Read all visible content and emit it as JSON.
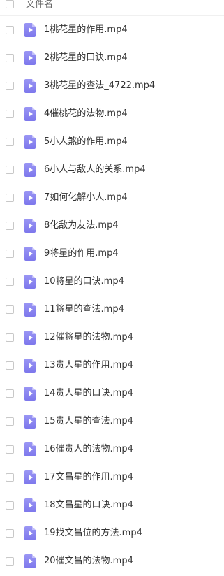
{
  "header": {
    "column_label": "文件名"
  },
  "files": [
    {
      "name": "1桃花星的作用.mp4",
      "icon": "video-file-icon"
    },
    {
      "name": "2桃花星的口诀.mp4",
      "icon": "video-file-icon"
    },
    {
      "name": "3桃花星的查法_4722.mp4",
      "icon": "video-file-icon"
    },
    {
      "name": "4催桃花的法物.mp4",
      "icon": "video-file-icon"
    },
    {
      "name": "5小人煞的作用.mp4",
      "icon": "video-file-icon"
    },
    {
      "name": "6小人与敌人的关系.mp4",
      "icon": "video-file-icon"
    },
    {
      "name": "7如何化解小人.mp4",
      "icon": "video-file-icon"
    },
    {
      "name": "8化敌为友法.mp4",
      "icon": "video-file-icon"
    },
    {
      "name": "9将星的作用.mp4",
      "icon": "video-file-icon"
    },
    {
      "name": "10将星的口诀.mp4",
      "icon": "video-file-icon"
    },
    {
      "name": "11将星的查法.mp4",
      "icon": "video-file-icon"
    },
    {
      "name": "12催将星的法物.mp4",
      "icon": "video-file-icon"
    },
    {
      "name": "13贵人星的作用.mp4",
      "icon": "video-file-icon"
    },
    {
      "name": "14贵人星的口诀.mp4",
      "icon": "video-file-icon"
    },
    {
      "name": "15贵人星的查法.mp4",
      "icon": "video-file-icon"
    },
    {
      "name": "16催贵人的法物.mp4",
      "icon": "video-file-icon"
    },
    {
      "name": "17文昌星的作用.mp4",
      "icon": "video-file-icon"
    },
    {
      "name": "18文昌星的口诀.mp4",
      "icon": "video-file-icon"
    },
    {
      "name": "19找文昌位的方法.mp4",
      "icon": "video-file-icon"
    },
    {
      "name": "20催文昌的法物.mp4",
      "icon": "video-file-icon"
    }
  ],
  "colors": {
    "icon_accent": "#8a85f0",
    "text": "#333333",
    "header_text": "#666666",
    "checkbox_border": "#c8c8c8"
  }
}
